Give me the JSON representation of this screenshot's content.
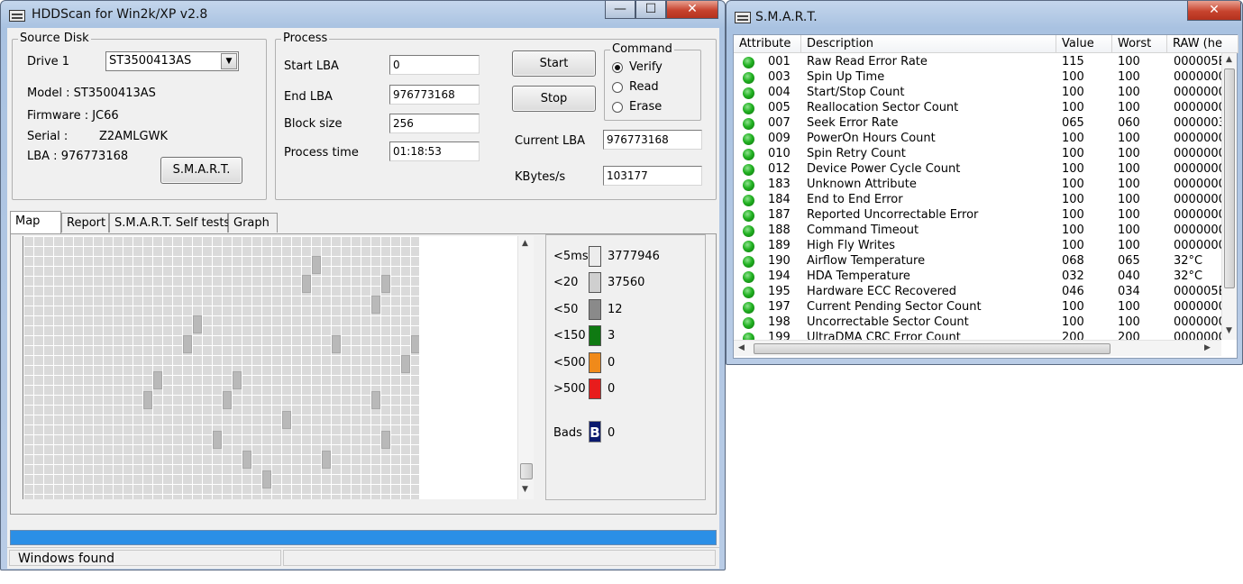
{
  "hdd_window": {
    "title": "HDDScan for Win2k/XP  v2.8",
    "controls": {
      "minimize": "—",
      "maximize": "☐",
      "close": "✕"
    },
    "source_disk": {
      "group_label": "Source Disk",
      "drive_label": "Drive  1",
      "drive_value": "ST3500413AS",
      "model": "Model : ST3500413AS",
      "firmware": "Firmware : JC66",
      "serial_label": "Serial :",
      "serial_value": "Z2AMLGWK",
      "lba": "LBA :  976773168",
      "smart_button": "S.M.A.R.T."
    },
    "process": {
      "group_label": "Process",
      "start_lba_label": "Start LBA",
      "start_lba_value": "0",
      "end_lba_label": "End LBA",
      "end_lba_value": "976773168",
      "block_size_label": "Block size",
      "block_size_value": "256",
      "process_time_label": "Process time",
      "process_time_value": "01:18:53",
      "start_button": "Start",
      "stop_button": "Stop",
      "current_lba_label": "Current LBA",
      "current_lba_value": "976773168",
      "kbytes_label": "KBytes/s",
      "kbytes_value": "103177"
    },
    "command": {
      "group_label": "Command",
      "options": [
        "Verify",
        "Read",
        "Erase"
      ],
      "selected": "Verify"
    },
    "tabs": [
      "Map",
      "Report",
      "S.M.A.R.T. Self tests",
      "Graph"
    ],
    "active_tab": "Map",
    "legend": [
      {
        "label": "<5ms",
        "count": "3777946",
        "color": "#ececec"
      },
      {
        "label": "<20",
        "count": "37560",
        "color": "#cfcfcf"
      },
      {
        "label": "<50",
        "count": "12",
        "color": "#8a8a8a"
      },
      {
        "label": "<150",
        "count": "3",
        "color": "#0f7a12"
      },
      {
        "label": "<500",
        "count": "0",
        "color": "#f08a1a"
      },
      {
        "label": ">500",
        "count": "0",
        "color": "#e81c1c"
      }
    ],
    "bads": {
      "label": "Bads",
      "icon": "B",
      "count": "0",
      "color": "#0b1a6e"
    },
    "status_text": "Windows  found",
    "progress_fraction": 1.0
  },
  "smart_window": {
    "title": "S.M.A.R.T.",
    "close": "✕",
    "columns": [
      "Attribute",
      "Description",
      "Value",
      "Worst",
      "RAW (he"
    ],
    "rows": [
      {
        "id": "001",
        "desc": "Raw Read Error Rate",
        "value": "115",
        "worst": "100",
        "raw": "000005E"
      },
      {
        "id": "003",
        "desc": "Spin Up Time",
        "value": "100",
        "worst": "100",
        "raw": "0000000"
      },
      {
        "id": "004",
        "desc": "Start/Stop Count",
        "value": "100",
        "worst": "100",
        "raw": "0000000"
      },
      {
        "id": "005",
        "desc": "Reallocation Sector Count",
        "value": "100",
        "worst": "100",
        "raw": "0000000"
      },
      {
        "id": "007",
        "desc": "Seek Error Rate",
        "value": "065",
        "worst": "060",
        "raw": "0000003"
      },
      {
        "id": "009",
        "desc": "PowerOn Hours Count",
        "value": "100",
        "worst": "100",
        "raw": "0000000"
      },
      {
        "id": "010",
        "desc": "Spin Retry Count",
        "value": "100",
        "worst": "100",
        "raw": "0000000"
      },
      {
        "id": "012",
        "desc": "Device Power Cycle Count",
        "value": "100",
        "worst": "100",
        "raw": "0000000"
      },
      {
        "id": "183",
        "desc": "Unknown Attribute",
        "value": "100",
        "worst": "100",
        "raw": "0000000"
      },
      {
        "id": "184",
        "desc": "End to End Error",
        "value": "100",
        "worst": "100",
        "raw": "0000000"
      },
      {
        "id": "187",
        "desc": "Reported Uncorrectable Error",
        "value": "100",
        "worst": "100",
        "raw": "0000000"
      },
      {
        "id": "188",
        "desc": "Command Timeout",
        "value": "100",
        "worst": "100",
        "raw": "0000000"
      },
      {
        "id": "189",
        "desc": "High Fly Writes",
        "value": "100",
        "worst": "100",
        "raw": "0000000"
      },
      {
        "id": "190",
        "desc": "Airflow Temperature",
        "value": "068",
        "worst": "065",
        "raw": "32°C"
      },
      {
        "id": "194",
        "desc": "HDA Temperature",
        "value": "032",
        "worst": "040",
        "raw": "32°C"
      },
      {
        "id": "195",
        "desc": "Hardware ECC Recovered",
        "value": "046",
        "worst": "034",
        "raw": "000005E"
      },
      {
        "id": "197",
        "desc": "Current Pending Sector Count",
        "value": "100",
        "worst": "100",
        "raw": "0000000"
      },
      {
        "id": "198",
        "desc": "Uncorrectable Sector Count",
        "value": "100",
        "worst": "100",
        "raw": "0000000"
      },
      {
        "id": "199",
        "desc": "UltraDMA CRC Error Count",
        "value": "200",
        "worst": "200",
        "raw": "0000000"
      }
    ]
  }
}
